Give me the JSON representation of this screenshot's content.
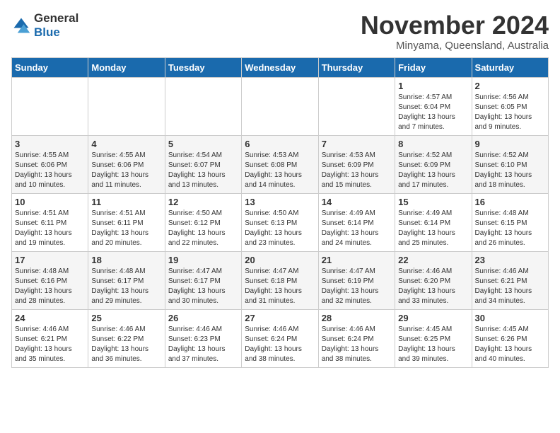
{
  "logo": {
    "general": "General",
    "blue": "Blue"
  },
  "title": "November 2024",
  "location": "Minyama, Queensland, Australia",
  "weekdays": [
    "Sunday",
    "Monday",
    "Tuesday",
    "Wednesday",
    "Thursday",
    "Friday",
    "Saturday"
  ],
  "weeks": [
    [
      {
        "day": "",
        "sunrise": "",
        "sunset": "",
        "daylight": ""
      },
      {
        "day": "",
        "sunrise": "",
        "sunset": "",
        "daylight": ""
      },
      {
        "day": "",
        "sunrise": "",
        "sunset": "",
        "daylight": ""
      },
      {
        "day": "",
        "sunrise": "",
        "sunset": "",
        "daylight": ""
      },
      {
        "day": "",
        "sunrise": "",
        "sunset": "",
        "daylight": ""
      },
      {
        "day": "1",
        "sunrise": "Sunrise: 4:57 AM",
        "sunset": "Sunset: 6:04 PM",
        "daylight": "Daylight: 13 hours and 7 minutes."
      },
      {
        "day": "2",
        "sunrise": "Sunrise: 4:56 AM",
        "sunset": "Sunset: 6:05 PM",
        "daylight": "Daylight: 13 hours and 9 minutes."
      }
    ],
    [
      {
        "day": "3",
        "sunrise": "Sunrise: 4:55 AM",
        "sunset": "Sunset: 6:06 PM",
        "daylight": "Daylight: 13 hours and 10 minutes."
      },
      {
        "day": "4",
        "sunrise": "Sunrise: 4:55 AM",
        "sunset": "Sunset: 6:06 PM",
        "daylight": "Daylight: 13 hours and 11 minutes."
      },
      {
        "day": "5",
        "sunrise": "Sunrise: 4:54 AM",
        "sunset": "Sunset: 6:07 PM",
        "daylight": "Daylight: 13 hours and 13 minutes."
      },
      {
        "day": "6",
        "sunrise": "Sunrise: 4:53 AM",
        "sunset": "Sunset: 6:08 PM",
        "daylight": "Daylight: 13 hours and 14 minutes."
      },
      {
        "day": "7",
        "sunrise": "Sunrise: 4:53 AM",
        "sunset": "Sunset: 6:09 PM",
        "daylight": "Daylight: 13 hours and 15 minutes."
      },
      {
        "day": "8",
        "sunrise": "Sunrise: 4:52 AM",
        "sunset": "Sunset: 6:09 PM",
        "daylight": "Daylight: 13 hours and 17 minutes."
      },
      {
        "day": "9",
        "sunrise": "Sunrise: 4:52 AM",
        "sunset": "Sunset: 6:10 PM",
        "daylight": "Daylight: 13 hours and 18 minutes."
      }
    ],
    [
      {
        "day": "10",
        "sunrise": "Sunrise: 4:51 AM",
        "sunset": "Sunset: 6:11 PM",
        "daylight": "Daylight: 13 hours and 19 minutes."
      },
      {
        "day": "11",
        "sunrise": "Sunrise: 4:51 AM",
        "sunset": "Sunset: 6:11 PM",
        "daylight": "Daylight: 13 hours and 20 minutes."
      },
      {
        "day": "12",
        "sunrise": "Sunrise: 4:50 AM",
        "sunset": "Sunset: 6:12 PM",
        "daylight": "Daylight: 13 hours and 22 minutes."
      },
      {
        "day": "13",
        "sunrise": "Sunrise: 4:50 AM",
        "sunset": "Sunset: 6:13 PM",
        "daylight": "Daylight: 13 hours and 23 minutes."
      },
      {
        "day": "14",
        "sunrise": "Sunrise: 4:49 AM",
        "sunset": "Sunset: 6:14 PM",
        "daylight": "Daylight: 13 hours and 24 minutes."
      },
      {
        "day": "15",
        "sunrise": "Sunrise: 4:49 AM",
        "sunset": "Sunset: 6:14 PM",
        "daylight": "Daylight: 13 hours and 25 minutes."
      },
      {
        "day": "16",
        "sunrise": "Sunrise: 4:48 AM",
        "sunset": "Sunset: 6:15 PM",
        "daylight": "Daylight: 13 hours and 26 minutes."
      }
    ],
    [
      {
        "day": "17",
        "sunrise": "Sunrise: 4:48 AM",
        "sunset": "Sunset: 6:16 PM",
        "daylight": "Daylight: 13 hours and 28 minutes."
      },
      {
        "day": "18",
        "sunrise": "Sunrise: 4:48 AM",
        "sunset": "Sunset: 6:17 PM",
        "daylight": "Daylight: 13 hours and 29 minutes."
      },
      {
        "day": "19",
        "sunrise": "Sunrise: 4:47 AM",
        "sunset": "Sunset: 6:17 PM",
        "daylight": "Daylight: 13 hours and 30 minutes."
      },
      {
        "day": "20",
        "sunrise": "Sunrise: 4:47 AM",
        "sunset": "Sunset: 6:18 PM",
        "daylight": "Daylight: 13 hours and 31 minutes."
      },
      {
        "day": "21",
        "sunrise": "Sunrise: 4:47 AM",
        "sunset": "Sunset: 6:19 PM",
        "daylight": "Daylight: 13 hours and 32 minutes."
      },
      {
        "day": "22",
        "sunrise": "Sunrise: 4:46 AM",
        "sunset": "Sunset: 6:20 PM",
        "daylight": "Daylight: 13 hours and 33 minutes."
      },
      {
        "day": "23",
        "sunrise": "Sunrise: 4:46 AM",
        "sunset": "Sunset: 6:21 PM",
        "daylight": "Daylight: 13 hours and 34 minutes."
      }
    ],
    [
      {
        "day": "24",
        "sunrise": "Sunrise: 4:46 AM",
        "sunset": "Sunset: 6:21 PM",
        "daylight": "Daylight: 13 hours and 35 minutes."
      },
      {
        "day": "25",
        "sunrise": "Sunrise: 4:46 AM",
        "sunset": "Sunset: 6:22 PM",
        "daylight": "Daylight: 13 hours and 36 minutes."
      },
      {
        "day": "26",
        "sunrise": "Sunrise: 4:46 AM",
        "sunset": "Sunset: 6:23 PM",
        "daylight": "Daylight: 13 hours and 37 minutes."
      },
      {
        "day": "27",
        "sunrise": "Sunrise: 4:46 AM",
        "sunset": "Sunset: 6:24 PM",
        "daylight": "Daylight: 13 hours and 38 minutes."
      },
      {
        "day": "28",
        "sunrise": "Sunrise: 4:46 AM",
        "sunset": "Sunset: 6:24 PM",
        "daylight": "Daylight: 13 hours and 38 minutes."
      },
      {
        "day": "29",
        "sunrise": "Sunrise: 4:45 AM",
        "sunset": "Sunset: 6:25 PM",
        "daylight": "Daylight: 13 hours and 39 minutes."
      },
      {
        "day": "30",
        "sunrise": "Sunrise: 4:45 AM",
        "sunset": "Sunset: 6:26 PM",
        "daylight": "Daylight: 13 hours and 40 minutes."
      }
    ]
  ]
}
